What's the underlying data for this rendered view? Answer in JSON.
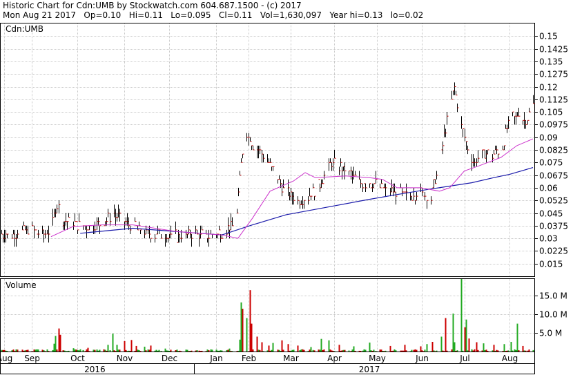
{
  "header": {
    "line1": "Historic Chart for Cdn:UMB by Stockwatch.com 604.687.1500 - (c) 2017",
    "line2": "Mon Aug 21 2017   Op=0.10   Hi=0.11   Lo=0.095   Cl=0.11   Vol=1,630,097   Year hi=0.13   lo=0.02"
  },
  "chart_data": [
    {
      "type": "line",
      "panel_label": "Cdn:UMB",
      "style": "ohlc-bars",
      "y_ticks": [
        "0.15",
        "0.1425",
        "0.135",
        "0.1275",
        "0.12",
        "0.1125",
        "0.105",
        "0.0975",
        "0.09",
        "0.0825",
        "0.075",
        "0.0675",
        "0.06",
        "0.0525",
        "0.045",
        "0.0375",
        "0.03",
        "0.0225",
        "0.015"
      ],
      "ylim": [
        0.0075,
        0.1575
      ],
      "grid": true,
      "colors": {
        "bar": "#000000",
        "close_tick": "#cc0000",
        "ma_short": "#cc33cc",
        "ma_long": "#1a1aaa"
      },
      "price_knots": [
        [
          "2016-08-22",
          0.032
        ],
        [
          "2016-09-01",
          0.033
        ],
        [
          "2016-09-10",
          0.035
        ],
        [
          "2016-09-17",
          0.032
        ],
        [
          "2016-09-24",
          0.034
        ],
        [
          "2016-09-29",
          0.05
        ],
        [
          "2016-10-03",
          0.041
        ],
        [
          "2016-10-12",
          0.038
        ],
        [
          "2016-10-22",
          0.037
        ],
        [
          "2016-10-30",
          0.038
        ],
        [
          "2016-11-06",
          0.045
        ],
        [
          "2016-11-15",
          0.039
        ],
        [
          "2016-11-22",
          0.036
        ],
        [
          "2016-12-01",
          0.033
        ],
        [
          "2016-12-10",
          0.032
        ],
        [
          "2016-12-20",
          0.031
        ],
        [
          "2017-01-01",
          0.033
        ],
        [
          "2017-01-10",
          0.031
        ],
        [
          "2017-01-20",
          0.034
        ],
        [
          "2017-01-29",
          0.038
        ],
        [
          "2017-02-02",
          0.075
        ],
        [
          "2017-02-05",
          0.095
        ],
        [
          "2017-02-10",
          0.085
        ],
        [
          "2017-02-18",
          0.078
        ],
        [
          "2017-02-25",
          0.07
        ],
        [
          "2017-03-02",
          0.06
        ],
        [
          "2017-03-12",
          0.052
        ],
        [
          "2017-03-22",
          0.056
        ],
        [
          "2017-03-30",
          0.065
        ],
        [
          "2017-04-05",
          0.075
        ],
        [
          "2017-04-15",
          0.07
        ],
        [
          "2017-04-25",
          0.063
        ],
        [
          "2017-05-05",
          0.062
        ],
        [
          "2017-05-15",
          0.058
        ],
        [
          "2017-05-25",
          0.055
        ],
        [
          "2017-06-05",
          0.057
        ],
        [
          "2017-06-12",
          0.054
        ],
        [
          "2017-06-18",
          0.075
        ],
        [
          "2017-06-22",
          0.095
        ],
        [
          "2017-06-28",
          0.12
        ],
        [
          "2017-07-02",
          0.1
        ],
        [
          "2017-07-08",
          0.08
        ],
        [
          "2017-07-12",
          0.075
        ],
        [
          "2017-07-18",
          0.08
        ],
        [
          "2017-07-25",
          0.08
        ],
        [
          "2017-07-31",
          0.085
        ],
        [
          "2017-08-05",
          0.1
        ],
        [
          "2017-08-11",
          0.104
        ],
        [
          "2017-08-16",
          0.1
        ],
        [
          "2017-08-21",
          0.11
        ]
      ],
      "ma_short_knots": [
        [
          "2016-09-25",
          0.031
        ],
        [
          "2016-10-10",
          0.037
        ],
        [
          "2016-10-30",
          0.038
        ],
        [
          "2016-11-20",
          0.038
        ],
        [
          "2016-12-20",
          0.034
        ],
        [
          "2017-01-20",
          0.032
        ],
        [
          "2017-01-31",
          0.03
        ],
        [
          "2017-02-10",
          0.042
        ],
        [
          "2017-02-22",
          0.058
        ],
        [
          "2017-03-10",
          0.064
        ],
        [
          "2017-03-18",
          0.069
        ],
        [
          "2017-03-25",
          0.066
        ],
        [
          "2017-04-15",
          0.067
        ],
        [
          "2017-05-01",
          0.066
        ],
        [
          "2017-05-10",
          0.065
        ],
        [
          "2017-05-20",
          0.06
        ],
        [
          "2017-06-05",
          0.06
        ],
        [
          "2017-06-18",
          0.058
        ],
        [
          "2017-06-25",
          0.06
        ],
        [
          "2017-07-05",
          0.07
        ],
        [
          "2017-07-15",
          0.073
        ],
        [
          "2017-07-30",
          0.078
        ],
        [
          "2017-08-10",
          0.085
        ],
        [
          "2017-08-21",
          0.089
        ]
      ],
      "ma_long_knots": [
        [
          "2016-10-15",
          0.033
        ],
        [
          "2016-11-20",
          0.036
        ],
        [
          "2016-12-20",
          0.034
        ],
        [
          "2017-01-20",
          0.032
        ],
        [
          "2017-02-10",
          0.038
        ],
        [
          "2017-03-05",
          0.044
        ],
        [
          "2017-03-30",
          0.048
        ],
        [
          "2017-04-30",
          0.053
        ],
        [
          "2017-05-20",
          0.056
        ],
        [
          "2017-06-10",
          0.059
        ],
        [
          "2017-06-25",
          0.061
        ],
        [
          "2017-07-10",
          0.063
        ],
        [
          "2017-07-25",
          0.066
        ],
        [
          "2017-08-05",
          0.068
        ],
        [
          "2017-08-21",
          0.072
        ]
      ]
    },
    {
      "type": "bar",
      "panel_label": "Volume",
      "y_ticks": [
        "15.0 M",
        "10.0 M",
        "5.0 M"
      ],
      "ylim": [
        0,
        19.5
      ],
      "unit": "M",
      "colors": {
        "up": "#22aa22",
        "down": "#cc0000"
      },
      "spikes": [
        [
          "2016-09-27",
          2.1,
          "up"
        ],
        [
          "2016-09-28",
          4.2,
          "up"
        ],
        [
          "2016-09-30",
          6.2,
          "down"
        ],
        [
          "2016-10-01",
          4.5,
          "down"
        ],
        [
          "2016-10-10",
          0.9,
          "up"
        ],
        [
          "2016-10-15",
          0.6,
          "up"
        ],
        [
          "2016-10-20",
          1.0,
          "down"
        ],
        [
          "2016-11-03",
          1.8,
          "up"
        ],
        [
          "2016-11-06",
          4.8,
          "up"
        ],
        [
          "2016-11-09",
          1.8,
          "up"
        ],
        [
          "2016-11-14",
          2.8,
          "down"
        ],
        [
          "2016-11-19",
          3.1,
          "down"
        ],
        [
          "2016-11-22",
          1.5,
          "down"
        ],
        [
          "2016-11-28",
          1.3,
          "up"
        ],
        [
          "2016-12-02",
          1.6,
          "down"
        ],
        [
          "2016-12-12",
          0.8,
          "up"
        ],
        [
          "2017-01-10",
          0.5,
          "up"
        ],
        [
          "2017-01-25",
          0.8,
          "up"
        ],
        [
          "2017-02-01",
          3.2,
          "up"
        ],
        [
          "2017-02-02",
          13.2,
          "up"
        ],
        [
          "2017-02-03",
          11.5,
          "down"
        ],
        [
          "2017-02-06",
          9.0,
          "up"
        ],
        [
          "2017-02-08",
          16.5,
          "down"
        ],
        [
          "2017-02-09",
          7.5,
          "down"
        ],
        [
          "2017-02-13",
          4.0,
          "down"
        ],
        [
          "2017-02-16",
          2.5,
          "down"
        ],
        [
          "2017-02-21",
          1.6,
          "down"
        ],
        [
          "2017-02-24",
          2.3,
          "up"
        ],
        [
          "2017-03-02",
          3.0,
          "down"
        ],
        [
          "2017-03-06",
          2.0,
          "down"
        ],
        [
          "2017-03-13",
          1.6,
          "down"
        ],
        [
          "2017-03-22",
          1.2,
          "up"
        ],
        [
          "2017-03-29",
          3.4,
          "up"
        ],
        [
          "2017-04-03",
          3.0,
          "up"
        ],
        [
          "2017-04-10",
          1.8,
          "down"
        ],
        [
          "2017-04-20",
          1.4,
          "up"
        ],
        [
          "2017-05-01",
          2.4,
          "up"
        ],
        [
          "2017-05-15",
          1.5,
          "down"
        ],
        [
          "2017-05-25",
          1.8,
          "down"
        ],
        [
          "2017-06-05",
          1.4,
          "down"
        ],
        [
          "2017-06-09",
          2.0,
          "up"
        ],
        [
          "2017-06-13",
          2.6,
          "down"
        ],
        [
          "2017-06-19",
          4.0,
          "up"
        ],
        [
          "2017-06-22",
          9.0,
          "down"
        ],
        [
          "2017-06-27",
          10.2,
          "up"
        ],
        [
          "2017-06-28",
          2.5,
          "up"
        ],
        [
          "2017-07-03",
          19.5,
          "up"
        ],
        [
          "2017-07-05",
          6.5,
          "down"
        ],
        [
          "2017-07-06",
          8.6,
          "up"
        ],
        [
          "2017-07-08",
          3.5,
          "down"
        ],
        [
          "2017-07-13",
          2.5,
          "down"
        ],
        [
          "2017-07-18",
          2.2,
          "up"
        ],
        [
          "2017-07-25",
          1.8,
          "down"
        ],
        [
          "2017-08-01",
          2.0,
          "up"
        ],
        [
          "2017-08-06",
          2.6,
          "up"
        ],
        [
          "2017-08-10",
          7.5,
          "up"
        ],
        [
          "2017-08-14",
          1.5,
          "down"
        ]
      ]
    }
  ],
  "x_axis": {
    "months": [
      {
        "label": "Aug",
        "date": "2016-08-24"
      },
      {
        "label": "Sep",
        "date": "2016-09-12"
      },
      {
        "label": "Oct",
        "date": "2016-10-13"
      },
      {
        "label": "Nov",
        "date": "2016-11-14"
      },
      {
        "label": "Dec",
        "date": "2016-12-15"
      },
      {
        "label": "Jan",
        "date": "2017-01-16"
      },
      {
        "label": "Feb",
        "date": "2017-02-07"
      },
      {
        "label": "Mar",
        "date": "2017-03-08"
      },
      {
        "label": "Apr",
        "date": "2017-04-07"
      },
      {
        "label": "May",
        "date": "2017-05-06"
      },
      {
        "label": "Jun",
        "date": "2017-06-06"
      },
      {
        "label": "Jul",
        "date": "2017-07-05"
      },
      {
        "label": "Aug",
        "date": "2017-08-05"
      }
    ],
    "years": [
      {
        "label": "2016",
        "date": "2016-10-25"
      },
      {
        "label": "2017",
        "date": "2017-05-01"
      }
    ],
    "start": "2016-08-22",
    "end": "2017-08-21",
    "year_boundary": "2017-01-01"
  }
}
